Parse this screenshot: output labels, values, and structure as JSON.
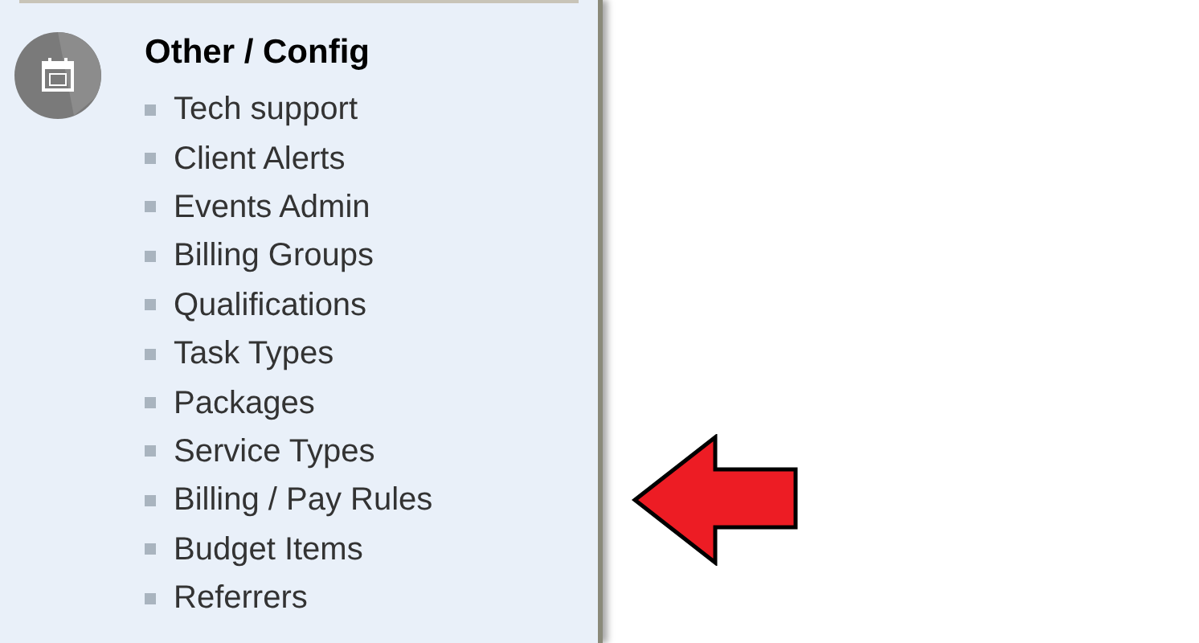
{
  "section": {
    "title": "Other / Config",
    "items": [
      {
        "label": "Tech support",
        "highlighted": false
      },
      {
        "label": "Client Alerts",
        "highlighted": false
      },
      {
        "label": "Events Admin",
        "highlighted": false
      },
      {
        "label": "Billing Groups",
        "highlighted": false
      },
      {
        "label": "Qualifications",
        "highlighted": false
      },
      {
        "label": "Task Types",
        "highlighted": false
      },
      {
        "label": "Packages",
        "highlighted": false
      },
      {
        "label": "Service Types",
        "highlighted": false
      },
      {
        "label": "Billing / Pay Rules",
        "highlighted": true
      },
      {
        "label": "Budget Items",
        "highlighted": false
      },
      {
        "label": "Referrers",
        "highlighted": false
      }
    ]
  }
}
